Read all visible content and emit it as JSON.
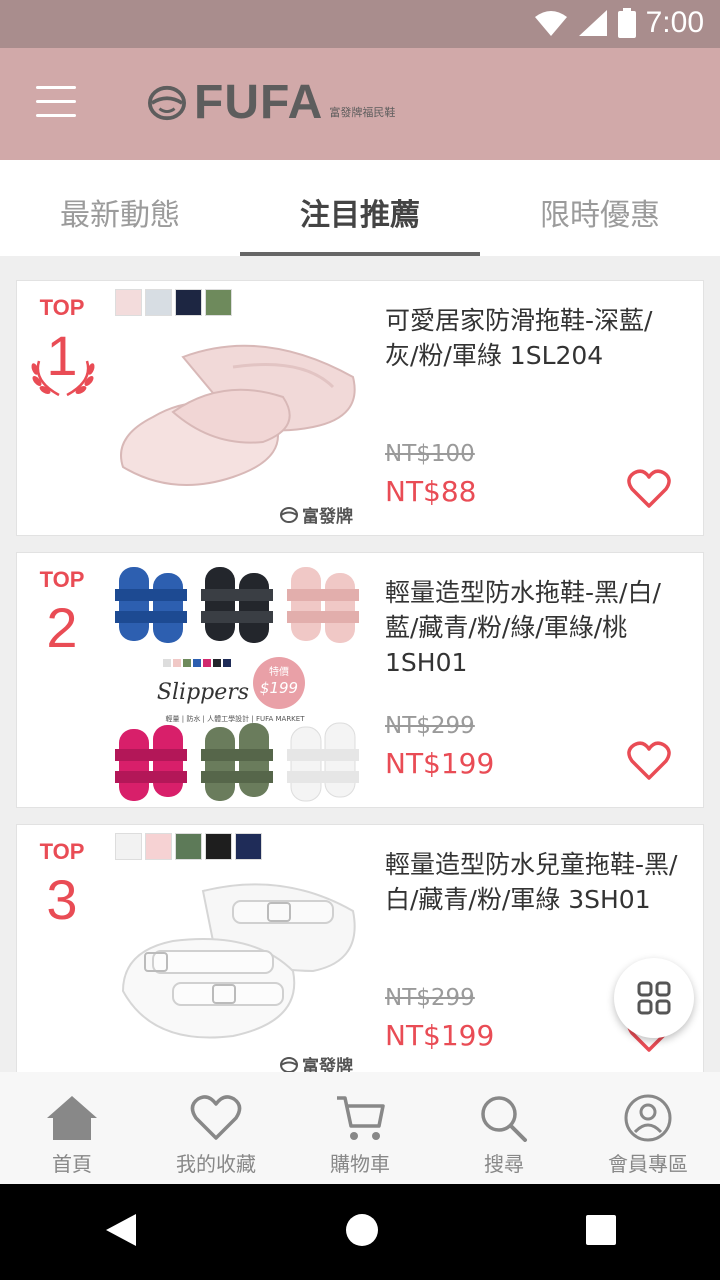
{
  "status_bar": {
    "time": "7:00"
  },
  "app_bar": {
    "logo_text": "FUFA",
    "logo_tagline": "富發牌福民鞋"
  },
  "tabs": [
    {
      "label": "最新動態"
    },
    {
      "label": "注目推薦"
    },
    {
      "label": "限時優惠"
    }
  ],
  "products": [
    {
      "rank_label": "TOP",
      "rank": "1",
      "title": "可愛居家防滑拖鞋-深藍/灰/粉/軍綠 1SL204",
      "old_price": "NT$100",
      "price": "NT$88",
      "swatches": [
        "#f3dcdc",
        "#d7dde3",
        "#1d2642",
        "#6e8a5c"
      ],
      "brand": "富發牌"
    },
    {
      "rank_label": "TOP",
      "rank": "2",
      "title": "輕量造型防水拖鞋-黑/白/藍/藏青/粉/綠/軍綠/桃 1SH01",
      "old_price": "NT$299",
      "price": "NT$199",
      "promo_label": "特價",
      "promo_price": "$199",
      "promo_script": "Slippers",
      "promo_footer": "輕量 | 防水 | 人體工學設計 | FUFA MARKET"
    },
    {
      "rank_label": "TOP",
      "rank": "3",
      "title": "輕量造型防水兒童拖鞋-黑/白/藏青/粉/軍綠 3SH01",
      "old_price": "NT$299",
      "price": "NT$199",
      "swatches": [
        "#f2f2f2",
        "#f6d2d3",
        "#5d7a58",
        "#1e1e1e",
        "#1f2c58"
      ],
      "brand": "富發牌"
    }
  ],
  "bottom_nav": [
    {
      "label": "首頁"
    },
    {
      "label": "我的收藏"
    },
    {
      "label": "購物車"
    },
    {
      "label": "搜尋"
    },
    {
      "label": "會員專區"
    }
  ],
  "colors": {
    "status_bar": "#a98d8d",
    "app_bar": "#d1a9a9",
    "accent_red": "#e94c55"
  }
}
